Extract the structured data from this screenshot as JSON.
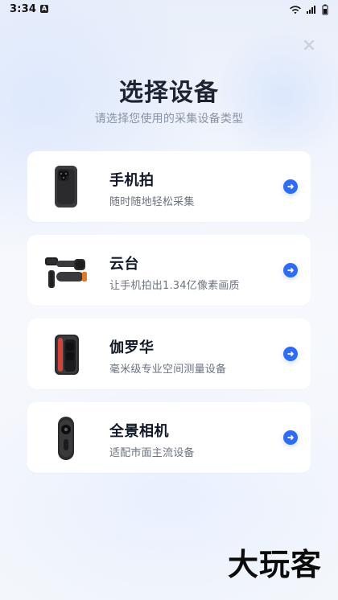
{
  "status_bar": {
    "time": "3:34",
    "a_badge": "A",
    "icons": [
      "wifi-icon",
      "signal-icon",
      "battery-icon"
    ]
  },
  "header": {
    "title": "选择设备",
    "subtitle": "请选择您使用的采集设备类型"
  },
  "devices": [
    {
      "title": "手机拍",
      "desc": "随时随地轻松采集",
      "image_icon": "phone-device-icon"
    },
    {
      "title": "云台",
      "desc": "让手机拍出1.34亿像素画质",
      "image_icon": "gimbal-device-icon"
    },
    {
      "title": "伽罗华",
      "desc": "毫米级专业空间测量设备",
      "image_icon": "galois-device-icon"
    },
    {
      "title": "全景相机",
      "desc": "适配市面主流设备",
      "image_icon": "panorama-camera-icon"
    }
  ],
  "ui_icons": {
    "close": "close-icon",
    "arrow": "arrow-right-icon"
  },
  "colors": {
    "accent": "#2f6cf6",
    "title_text": "#1d2330",
    "subtitle_text": "#8a93a6",
    "card_bg": "#ffffff"
  },
  "watermark": "大玩客"
}
